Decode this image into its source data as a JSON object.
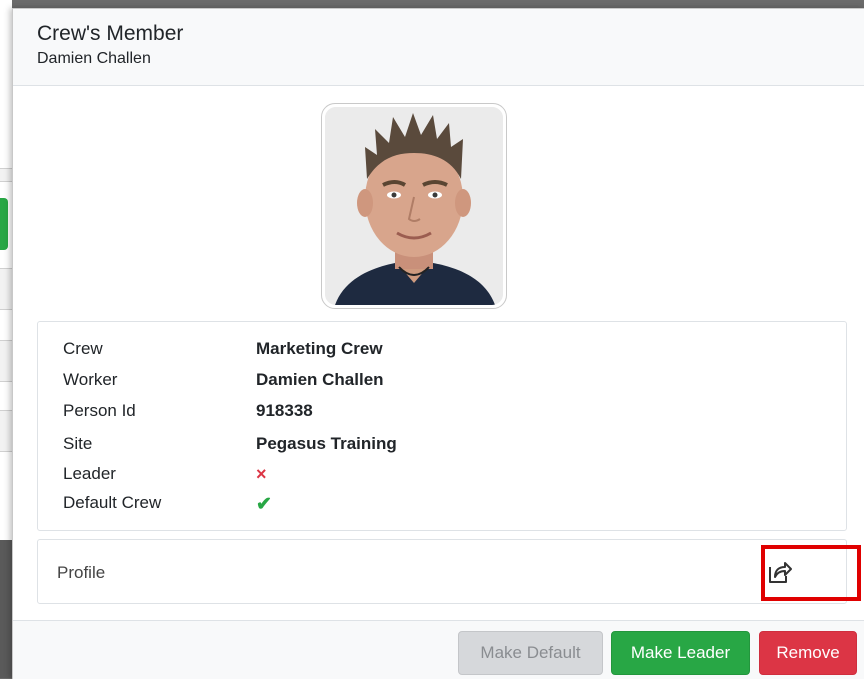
{
  "header": {
    "title": "Crew's Member",
    "subtitle": "Damien Challen"
  },
  "photo": {
    "alt": "Damien Challen"
  },
  "details": {
    "crew": {
      "label": "Crew",
      "value": "Marketing Crew"
    },
    "worker": {
      "label": "Worker",
      "value": "Damien Challen"
    },
    "person_id": {
      "label": "Person Id",
      "value": "918338"
    },
    "site": {
      "label": "Site",
      "value": "Pegasus Training"
    },
    "leader": {
      "label": "Leader",
      "value": "×",
      "state": false
    },
    "default_crew": {
      "label": "Default Crew",
      "value": "✔",
      "state": true
    }
  },
  "profile": {
    "label": "Profile",
    "action_icon": "share-external-icon"
  },
  "footer": {
    "make_default_label": "Make Default",
    "make_leader_label": "Make Leader",
    "remove_label": "Remove"
  },
  "colors": {
    "success": "#28a745",
    "danger": "#dc3545",
    "disabled": "#d6d8db",
    "highlight": "#e00000"
  }
}
